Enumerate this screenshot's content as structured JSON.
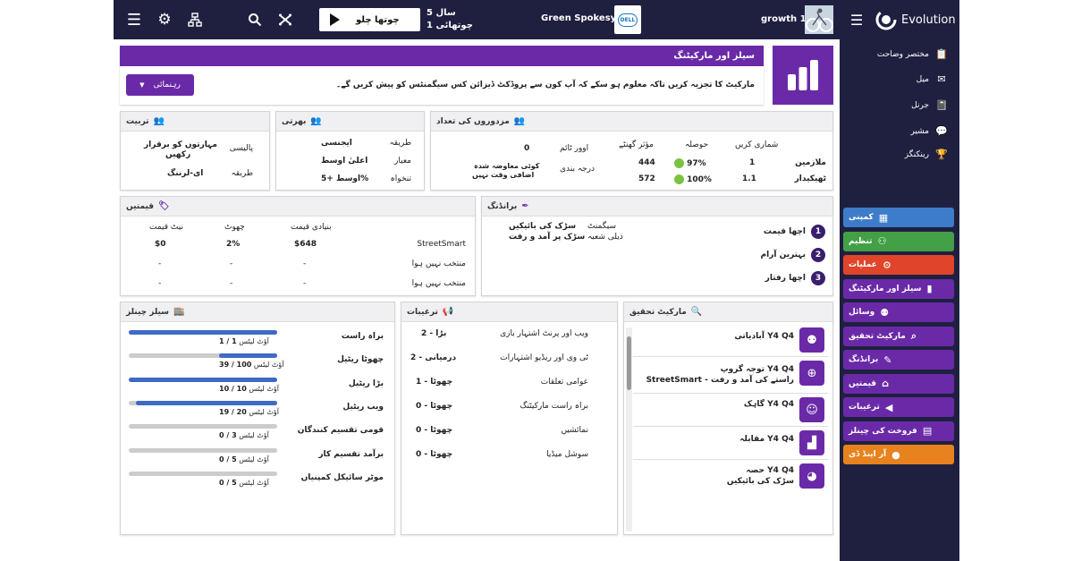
{
  "topbar": {
    "year_line": "سال 5",
    "quarter_line": "چوتھائی 1",
    "play_label": "چوتھا چلو",
    "company_name": "Green Spokesy",
    "company_logo_text": "DELL",
    "user_name": "growth 1",
    "app_name": "Evolution"
  },
  "nav": {
    "items": [
      {
        "label": "مختصر وضاحت",
        "icon": "clipboard-icon"
      },
      {
        "label": "میل",
        "icon": "mail-icon"
      },
      {
        "label": "جرنل",
        "icon": "journal-icon"
      },
      {
        "label": "مشیر",
        "icon": "chat-icon"
      },
      {
        "label": "رینکنگز",
        "icon": "ranking-icon"
      }
    ]
  },
  "sidebar": {
    "items": [
      {
        "label": "کمپنی",
        "color": "#3d7cc9",
        "icon": "building-icon"
      },
      {
        "label": "تنظیم",
        "color": "#43a047",
        "icon": "org-icon"
      },
      {
        "label": "عملیات",
        "color": "#e0452b",
        "icon": "gears-icon"
      },
      {
        "label": "سیلز اور مارکیٹنگ",
        "color": "#6a2aa8",
        "icon": "chart-icon"
      },
      {
        "label": "وسائل",
        "color": "#6a2aa8",
        "icon": "people-icon"
      },
      {
        "label": "مارکیٹ تحقیق",
        "color": "#6a2aa8",
        "icon": "search-icon"
      },
      {
        "label": "برانڈنگ",
        "color": "#6a2aa8",
        "icon": "pen-icon"
      },
      {
        "label": "قیمتیں",
        "color": "#6a2aa8",
        "icon": "tag-icon"
      },
      {
        "label": "ترغیبات",
        "color": "#6a2aa8",
        "icon": "megaphone-icon"
      },
      {
        "label": "فروخت کی چینلز",
        "color": "#6a2aa8",
        "icon": "store-icon"
      },
      {
        "label": "آر اینڈ ڈی",
        "color": "#e8821e",
        "icon": "bulb-icon"
      }
    ]
  },
  "header": {
    "title": "سیلز اور مارکیٹنگ",
    "description": "مارکیٹ کا تجزیہ کریں تاکہ معلوم ہو سکے کہ آپ کون سے پروڈکٹ ڈیزائن کس سیگمنٹس کو پیش کریں گے۔",
    "guide_button": "رہنمائی"
  },
  "workers": {
    "title": "مزدوروں کی تعداد",
    "col_count": "شماری کریں",
    "col_morale": "حوصلہ",
    "col_hours": "مؤثر گھنٹے",
    "col_overtime": "اوور ٹائم",
    "rows": [
      {
        "label": "ملازمین",
        "count": "1",
        "morale": "97%",
        "hours": "444"
      },
      {
        "label": "ٹھیکیدار",
        "count": "1.1",
        "morale": "100%",
        "hours": "572"
      }
    ],
    "overtime_value": "0",
    "grading_label": "درجہ بندی",
    "grading_value_1": "کوئی معاوضہ شدہ",
    "grading_value_2": "اضافی وقت نہیں"
  },
  "hiring": {
    "title": "بھرتی",
    "rows": [
      {
        "label": "طریقہ",
        "value": "ایجنسی"
      },
      {
        "label": "معیار",
        "value": "اعلیٰ اوسط"
      },
      {
        "label": "تنخواہ",
        "value": "اوسط +5%"
      }
    ]
  },
  "training": {
    "title": "تربیت",
    "rows": [
      {
        "label": "پالیسی",
        "value_1": "مہارتوں کو برقرار",
        "value_2": "رکھیں"
      },
      {
        "label": "طریقہ",
        "value_1": "ای-لرننگ",
        "value_2": ""
      }
    ]
  },
  "branding": {
    "title": "برانڈنگ",
    "segment_label": "سیگمنٹ",
    "subsegment_label": "ذیلی شعبہ",
    "segment_value": "سڑک کی بائیکیں",
    "subsegment_value": "سڑک پر آمد و رفت",
    "items": [
      {
        "num": "1",
        "label": "اچھا قیمت"
      },
      {
        "num": "2",
        "label": "بہترین آرام"
      },
      {
        "num": "3",
        "label": "اچھا رفتار"
      }
    ]
  },
  "prices": {
    "title": "قیمتیں",
    "col_base": "بنیادی قیمت",
    "col_discount": "چھوٹ",
    "col_net": "نیٹ قیمت",
    "rows": [
      {
        "name": "StreetSmart",
        "base": "$648",
        "discount": "2%",
        "net": "$0"
      },
      {
        "name": "منتخب نہیں ہوا",
        "base": "-",
        "discount": "-",
        "net": "-"
      },
      {
        "name": "منتخب نہیں ہوا",
        "base": "-",
        "discount": "-",
        "net": "-"
      }
    ]
  },
  "market_research": {
    "title": "مارکیٹ تحقیق",
    "items": [
      {
        "line1": "آبادیاتی Y4 Q4",
        "line2": "",
        "icon": "users-icon"
      },
      {
        "line1": "توجہ گروپ Y4 Q4",
        "line2": "StreetSmart - راستے کی آمد و رفت",
        "icon": "target-icon"
      },
      {
        "line1": "گاہک Y4 Q4",
        "line2": "",
        "icon": "smile-icon"
      },
      {
        "line1": "مقابلہ Y4 Q4",
        "line2": "",
        "icon": "podium-icon"
      },
      {
        "line1": "حصہ Y4 Q4",
        "line2": "سڑک کی بائیکیں",
        "icon": "pie-icon"
      }
    ]
  },
  "promotions": {
    "title": "ترغیبات",
    "rows": [
      {
        "label": "ویب اور پرنٹ اشتہار بازی",
        "value": "2 - بڑا"
      },
      {
        "label": "ٹی وی اور ریڈیو اشتہارات",
        "value": "2 - درمیانی"
      },
      {
        "label": "عوامی تعلقات",
        "value": "1 - چھوٹا"
      },
      {
        "label": "براہ راست مارکیٹنگ",
        "value": "0 - چھوٹا"
      },
      {
        "label": "نمائشیں",
        "value": "0 - چھوٹا"
      },
      {
        "label": "سوشل میڈیا",
        "value": "0 - چھوٹا"
      }
    ]
  },
  "channels": {
    "title": "سیلز چینلز",
    "outlet_word": "آؤٹ لیٹس",
    "rows": [
      {
        "label": "براہ راست",
        "count": "1 / 1",
        "fill": 1.0
      },
      {
        "label": "چھوٹا ریٹیل",
        "count": "100 / 39",
        "fill": 0.39
      },
      {
        "label": "بڑا ریٹیل",
        "count": "10 / 10",
        "fill": 1.0
      },
      {
        "label": "ویب ریٹیل",
        "count": "20 / 19",
        "fill": 0.95
      },
      {
        "label": "قومی تقسیم کنندگان",
        "count": "3 / 0",
        "fill": 0.0
      },
      {
        "label": "برآمد تقسیم کار",
        "count": "5 / 0",
        "fill": 0.0
      },
      {
        "label": "موٹر سائیکل کمپنیاں",
        "count": "5 / 0",
        "fill": 0.0
      }
    ]
  }
}
